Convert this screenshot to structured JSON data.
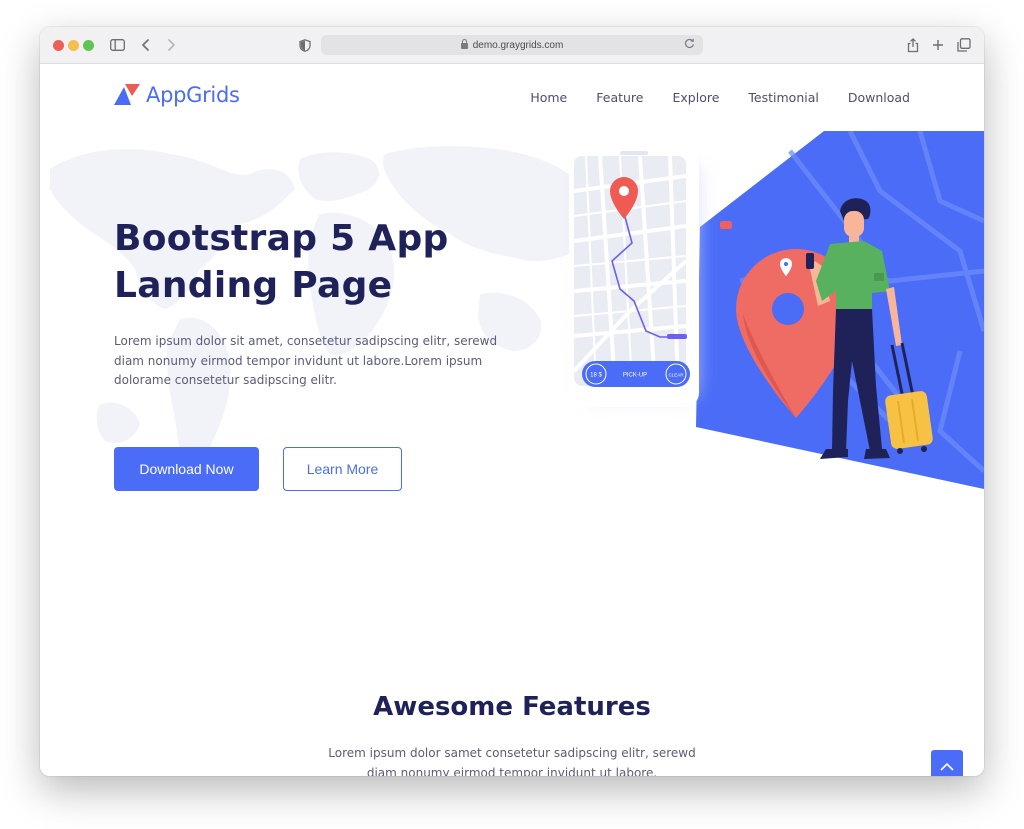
{
  "browser": {
    "url": "demo.graygrids.com"
  },
  "brand": {
    "name": "AppGrids",
    "accent": "#4a6cf7",
    "heading_color": "#1f2259"
  },
  "nav": {
    "items": [
      {
        "label": "Home"
      },
      {
        "label": "Feature"
      },
      {
        "label": "Explore"
      },
      {
        "label": "Testimonial"
      },
      {
        "label": "Download"
      }
    ]
  },
  "hero": {
    "title": "Bootstrap 5 App Landing Page",
    "text": "Lorem ipsum dolor sit amet, consetetur sadipscing elitr, serewd diam nonumy eirmod tempor invidunt ut labore.Lorem ipsum dolorame consetetur sadipscing elitr.",
    "primary_button": "Download Now",
    "secondary_button": "Learn More",
    "phone": {
      "left_badge": "18 $",
      "center_label": "PICK-UP",
      "right_badge": "CLEAR"
    }
  },
  "features": {
    "title": "Awesome Features",
    "text": "Lorem ipsum dolor samet consetetur sadipscing elitr, serewd diam nonumy eirmod tempor invidunt ut labore."
  },
  "icons": {
    "scroll_top": "chevron-up-icon",
    "share": "share-icon",
    "new_tab": "plus-icon",
    "tabs": "tabs-overview-icon"
  }
}
